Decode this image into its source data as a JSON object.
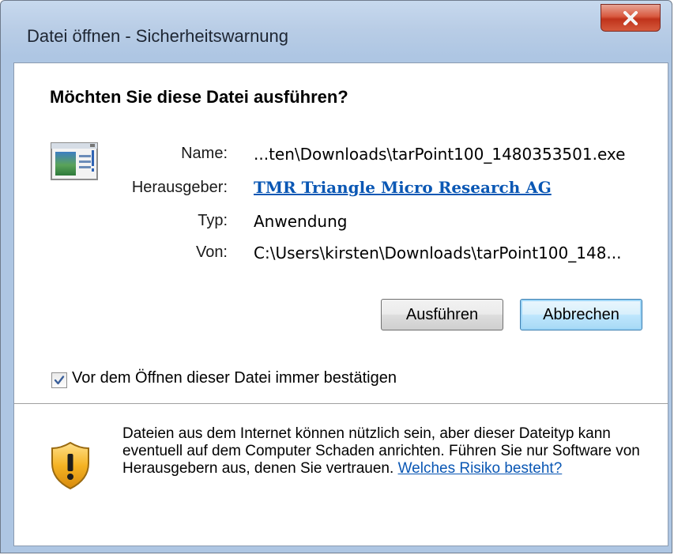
{
  "window": {
    "title": "Datei öffnen - Sicherheitswarnung",
    "close_icon": "close-x-icon"
  },
  "dialog": {
    "question": "Möchten Sie diese Datei ausführen?",
    "file_icon": "executable-file-icon",
    "fields": {
      "name_label": "Name:",
      "name_value": "...ten\\Downloads\\tarPoint100_1480353501.exe",
      "publisher_label": "Herausgeber:",
      "publisher_value": "TMR Triangle Micro Research AG",
      "type_label": "Typ:",
      "type_value": "Anwendung",
      "from_label": "Von:",
      "from_value": "C:\\Users\\kirsten\\Downloads\\tarPoint100_148..."
    },
    "buttons": {
      "run": "Ausführen",
      "cancel": "Abbrechen"
    },
    "checkbox": {
      "label": "Vor dem Öffnen dieser Datei immer bestätigen",
      "checked": true
    }
  },
  "footer": {
    "icon": "warning-shield-icon",
    "warning_text": "Dateien aus dem Internet können nützlich sein, aber dieser Dateityp kann eventuell auf dem Computer Schaden anrichten. Führen Sie nur Software von Herausgebern aus, denen Sie vertrauen. ",
    "risk_link": "Welches Risiko besteht?"
  },
  "colors": {
    "link": "#0a57b4",
    "close_button": "#c0331b",
    "titlebar": "#b9cde6"
  }
}
